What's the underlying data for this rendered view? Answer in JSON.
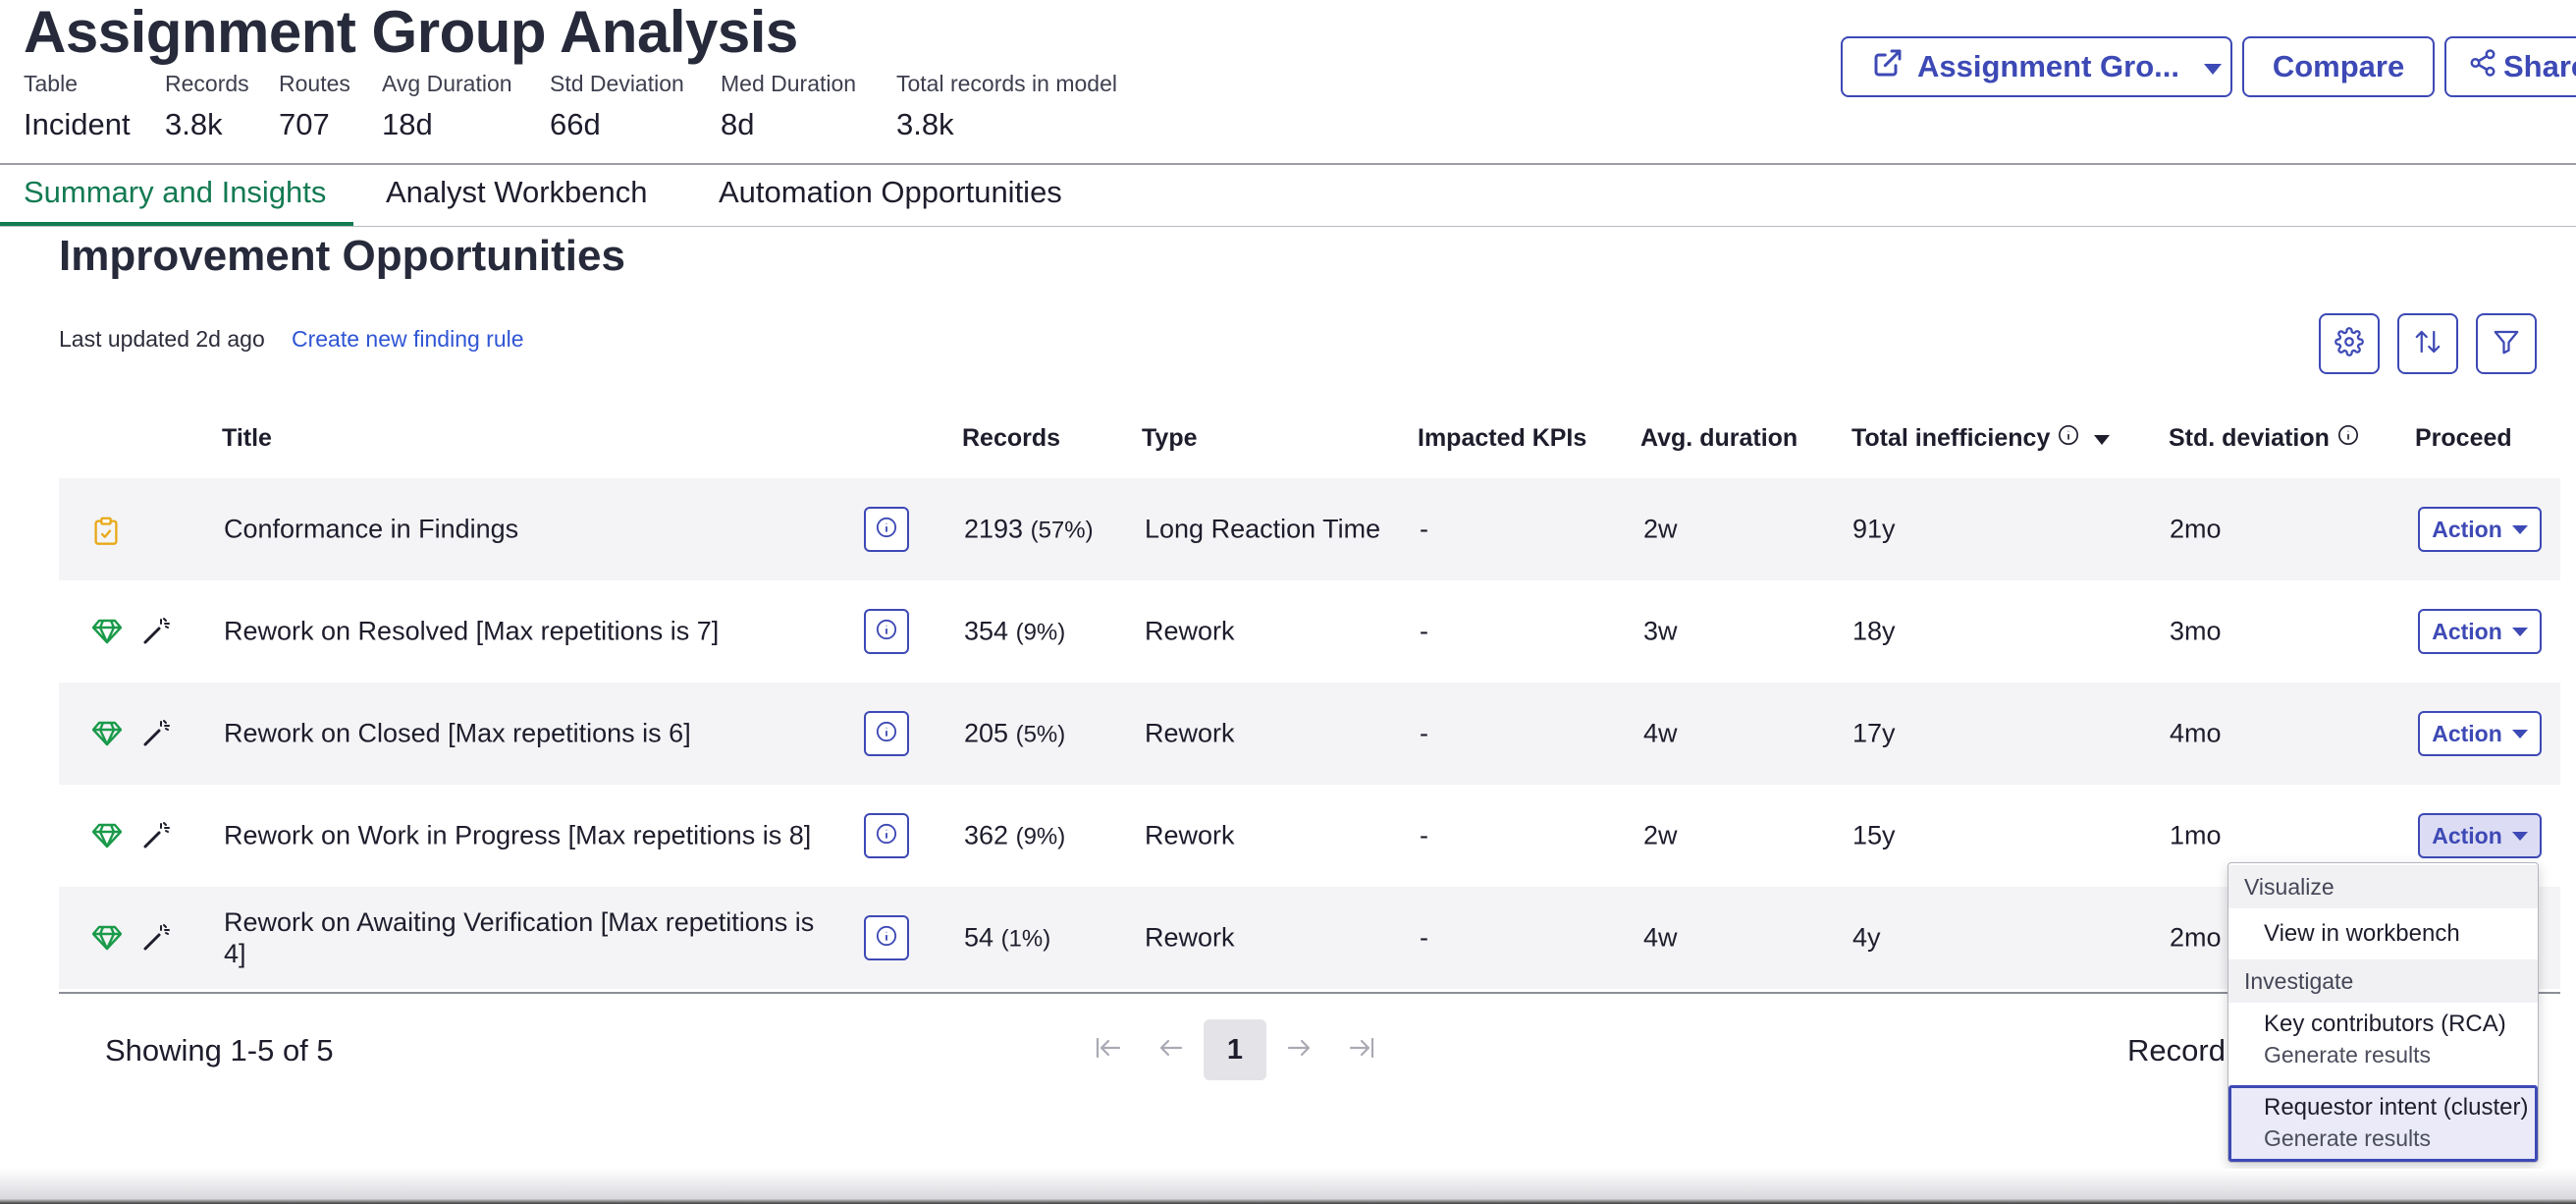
{
  "header": {
    "title": "Assignment Group Analysis",
    "stats": [
      {
        "label": "Table",
        "value": "Incident"
      },
      {
        "label": "Records",
        "value": "3.8k"
      },
      {
        "label": "Routes",
        "value": "707"
      },
      {
        "label": "Avg Duration",
        "value": "18d"
      },
      {
        "label": "Std Deviation",
        "value": "66d"
      },
      {
        "label": "Med Duration",
        "value": "8d"
      },
      {
        "label": "Total records in model",
        "value": "3.8k"
      }
    ],
    "buttons": {
      "assignment_group": "Assignment Gro...",
      "compare": "Compare",
      "share": "Share"
    }
  },
  "tabs": [
    {
      "label": "Summary and Insights",
      "active": true
    },
    {
      "label": "Analyst Workbench",
      "active": false
    },
    {
      "label": "Automation Opportunities",
      "active": false
    }
  ],
  "section": {
    "title": "Improvement Opportunities",
    "last_updated": "Last updated 2d ago",
    "create_link": "Create new finding rule"
  },
  "table": {
    "columns": {
      "title": "Title",
      "records": "Records",
      "type": "Type",
      "impacted_kpis": "Impacted KPIs",
      "avg_duration": "Avg. duration",
      "total_inefficiency": "Total inefficiency",
      "std_deviation": "Std. deviation",
      "proceed": "Proceed"
    },
    "action_label": "Action",
    "rows": [
      {
        "icon": "clipboard-check-icon",
        "title": "Conformance in Findings",
        "records": "2193",
        "pct": "(57%)",
        "type": "Long Reaction Time",
        "kpis": "-",
        "avg": "2w",
        "total": "91y",
        "std": "2mo"
      },
      {
        "icon": "gem-icon",
        "title": "Rework on Resolved [Max repetitions is 7]",
        "records": "354",
        "pct": "(9%)",
        "type": "Rework",
        "kpis": "-",
        "avg": "3w",
        "total": "18y",
        "std": "3mo"
      },
      {
        "icon": "gem-icon",
        "title": "Rework on Closed [Max repetitions is 6]",
        "records": "205",
        "pct": "(5%)",
        "type": "Rework",
        "kpis": "-",
        "avg": "4w",
        "total": "17y",
        "std": "4mo"
      },
      {
        "icon": "gem-icon",
        "title": "Rework on Work in Progress [Max repetitions is 8]",
        "records": "362",
        "pct": "(9%)",
        "type": "Rework",
        "kpis": "-",
        "avg": "2w",
        "total": "15y",
        "std": "1mo"
      },
      {
        "icon": "gem-icon",
        "title_line1": "Rework on Awaiting Verification [Max repetitions is",
        "title_line2": "4]",
        "records": "54",
        "pct": "(1%)",
        "type": "Rework",
        "kpis": "-",
        "avg": "4w",
        "total": "4y",
        "std": "2mo"
      }
    ]
  },
  "pagination": {
    "showing": "Showing 1-5 of 5",
    "current_page": "1",
    "records_label": "Record"
  },
  "action_menu": {
    "groups": [
      {
        "label": "Visualize",
        "items": [
          {
            "label": "View in workbench"
          }
        ]
      },
      {
        "label": "Investigate",
        "items": [
          {
            "label": "Key contributors (RCA)",
            "sub": "Generate results"
          },
          {
            "label": "Requestor intent (cluster)",
            "sub": "Generate results",
            "highlighted": true
          }
        ]
      }
    ]
  },
  "colors": {
    "accent": "#3d49b5",
    "tab_active": "#137a52",
    "link": "#2f55d4",
    "gem": "#1a9a4a",
    "clipboard": "#e8a817"
  }
}
